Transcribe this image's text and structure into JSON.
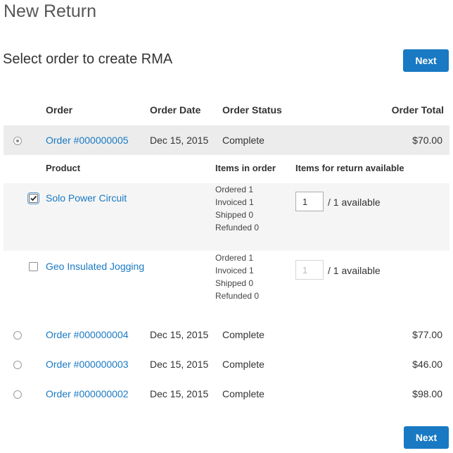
{
  "page": {
    "title": "New Return",
    "subtitle": "Select order to create RMA",
    "next_label": "Next"
  },
  "orders_table": {
    "headers": {
      "order": "Order",
      "order_date": "Order Date",
      "order_status": "Order Status",
      "order_total": "Order Total"
    },
    "rows": [
      {
        "order": "Order #000000005",
        "date": "Dec 15, 2015",
        "status": "Complete",
        "total": "$70.00",
        "selected": true
      },
      {
        "order": "Order #000000004",
        "date": "Dec 15, 2015",
        "status": "Complete",
        "total": "$77.00",
        "selected": false
      },
      {
        "order": "Order #000000003",
        "date": "Dec 15, 2015",
        "status": "Complete",
        "total": "$46.00",
        "selected": false
      },
      {
        "order": "Order #000000002",
        "date": "Dec 15, 2015",
        "status": "Complete",
        "total": "$98.00",
        "selected": false
      }
    ]
  },
  "products_table": {
    "headers": {
      "product": "Product",
      "items_in_order": "Items in order",
      "items_for_return": "Items for return available"
    },
    "rows": [
      {
        "name": "Solo Power Circuit",
        "checked": true,
        "ordered": "Ordered 1",
        "invoiced": "Invoiced 1",
        "shipped": "Shipped 0",
        "refunded": "Refunded 0",
        "qty": "1",
        "available": "/ 1 available"
      },
      {
        "name": "Geo Insulated Jogging",
        "checked": false,
        "ordered": "Ordered 1",
        "invoiced": "Invoiced 1",
        "shipped": "Shipped 0",
        "refunded": "Refunded 0",
        "qty": "1",
        "available": "/ 1 available"
      }
    ]
  },
  "colors": {
    "accent": "#1979c3",
    "link": "#1979c3",
    "selected_row_bg": "#ececec",
    "expanded_row_bg": "#f5f5f5"
  }
}
